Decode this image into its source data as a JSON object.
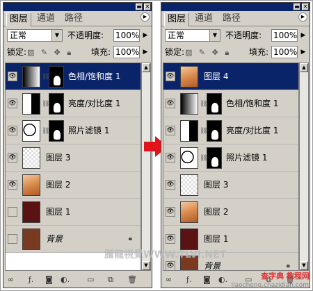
{
  "panels": [
    {
      "tabs": [
        "图层",
        "通道",
        "路径"
      ],
      "blend_mode": "正常",
      "opacity_label": "不透明度:",
      "opacity_value": "100%",
      "lock_label": "锁定:",
      "fill_label": "填充:",
      "fill_value": "100%",
      "layers": [
        {
          "name": "色相/饱和度 1",
          "kind": "adjust-gradient",
          "visible": true,
          "selected": true
        },
        {
          "name": "亮度/对比度 1",
          "kind": "adjust-contrast",
          "visible": true,
          "selected": false
        },
        {
          "name": "照片滤镜 1",
          "kind": "adjust-filter",
          "visible": true,
          "selected": false
        },
        {
          "name": "图层 3",
          "kind": "transparent",
          "visible": true,
          "selected": false
        },
        {
          "name": "图层 2",
          "kind": "photo",
          "visible": true,
          "selected": false
        },
        {
          "name": "图层 1",
          "kind": "dark-red",
          "visible": false,
          "selected": false
        },
        {
          "name": "背景",
          "kind": "background",
          "visible": false,
          "selected": false,
          "italic": true
        }
      ]
    },
    {
      "tabs": [
        "图层",
        "通道",
        "路径"
      ],
      "blend_mode": "正常",
      "opacity_label": "不透明度:",
      "opacity_value": "100%",
      "lock_label": "锁定:",
      "fill_label": "填充:",
      "fill_value": "100%",
      "layers": [
        {
          "name": "图层 4",
          "kind": "photo",
          "visible": true,
          "selected": true
        },
        {
          "name": "色相/饱和度 1",
          "kind": "adjust-gradient",
          "visible": true,
          "selected": false
        },
        {
          "name": "亮度/对比度 1",
          "kind": "adjust-contrast",
          "visible": true,
          "selected": false
        },
        {
          "name": "照片滤镜 1",
          "kind": "adjust-filter",
          "visible": true,
          "selected": false
        },
        {
          "name": "图层 3",
          "kind": "transparent",
          "visible": true,
          "selected": false
        },
        {
          "name": "图层 2",
          "kind": "photo",
          "visible": true,
          "selected": false
        },
        {
          "name": "图层 1",
          "kind": "dark-red",
          "visible": true,
          "selected": false
        },
        {
          "name": "背景",
          "kind": "background",
          "visible": true,
          "selected": false,
          "italic": true
        }
      ]
    }
  ],
  "watermark": "騰龍視覺WWW.TLVI.NET",
  "site_watermark": "查字典 教程网",
  "site_url": "jiaocheng.chazidian.com",
  "colors": {
    "selected": "#0a246a",
    "arrow": "#e0141a",
    "panel": "#d4d0c8"
  }
}
